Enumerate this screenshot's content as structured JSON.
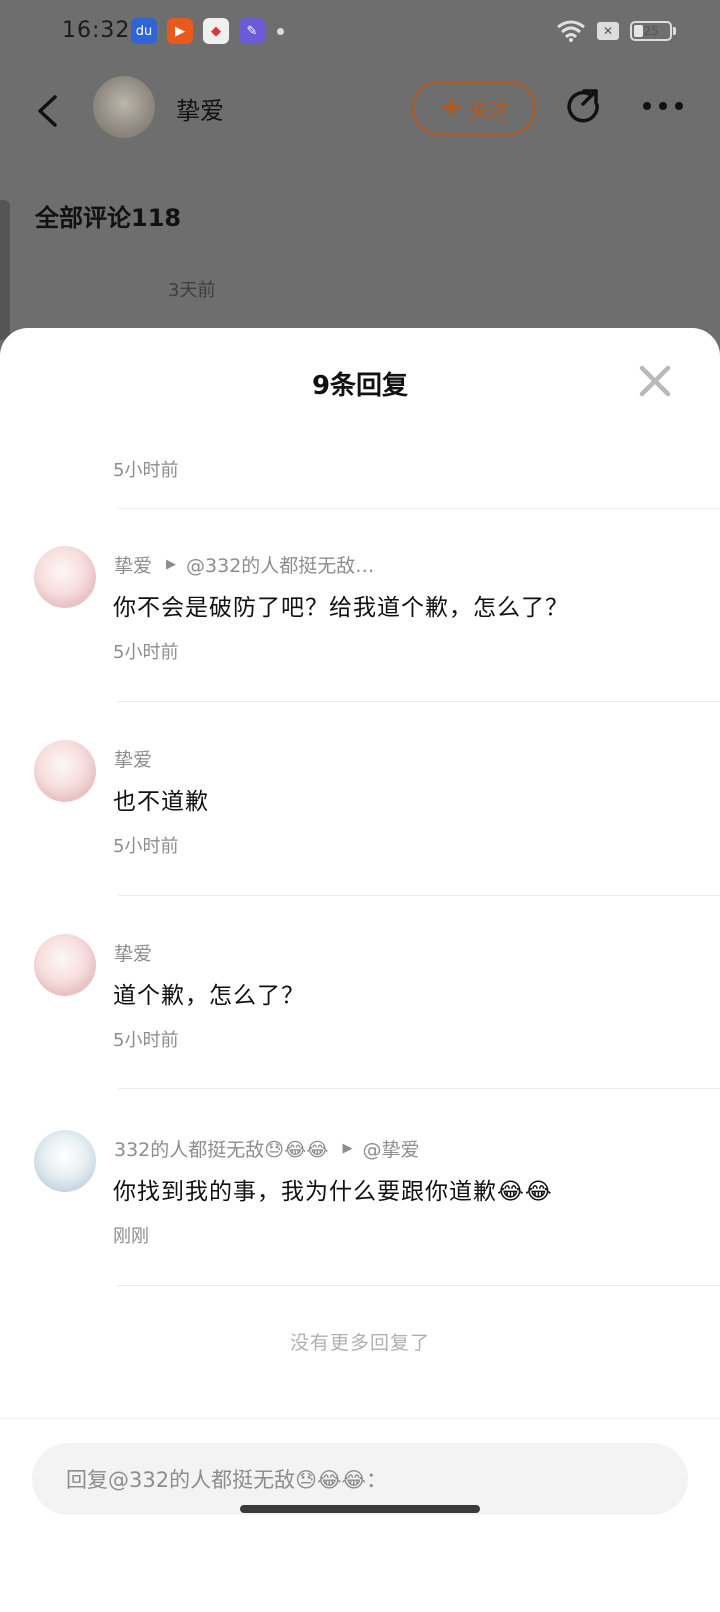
{
  "status_bar": {
    "time": "16:32",
    "battery": "25",
    "battery_level": 0.25,
    "apps": [
      "baidu-app-icon",
      "kuaishou-app-icon",
      "maps-app-icon",
      "pen-app-icon"
    ]
  },
  "header": {
    "author_name": "挚爱",
    "follow_label": "关注",
    "follow_color": "#b4571e"
  },
  "background": {
    "all_comments": "全部评论118",
    "comment_time": "3天前"
  },
  "sheet": {
    "title": "9条回复",
    "first_time": "5小时前",
    "replies": [
      {
        "author": "挚爱",
        "reply_to": "@332的人都挺无敌…",
        "text": "你不会是破防了吧？给我道个歉，怎么了？",
        "time": "5小时前"
      },
      {
        "author": "挚爱",
        "reply_to": "",
        "text": "也不道歉",
        "time": "5小时前"
      },
      {
        "author": "挚爱",
        "reply_to": "",
        "text": "道个歉，怎么了？",
        "time": "5小时前"
      },
      {
        "author": "332的人都挺无敌😓😂😂",
        "reply_to": "@挚爱",
        "text": "你找到我的事，我为什么要跟你道歉😂😂",
        "time": "刚刚"
      }
    ],
    "no_more": "没有更多回复了",
    "input_placeholder": "回复@332的人都挺无敌😓😂😂："
  }
}
